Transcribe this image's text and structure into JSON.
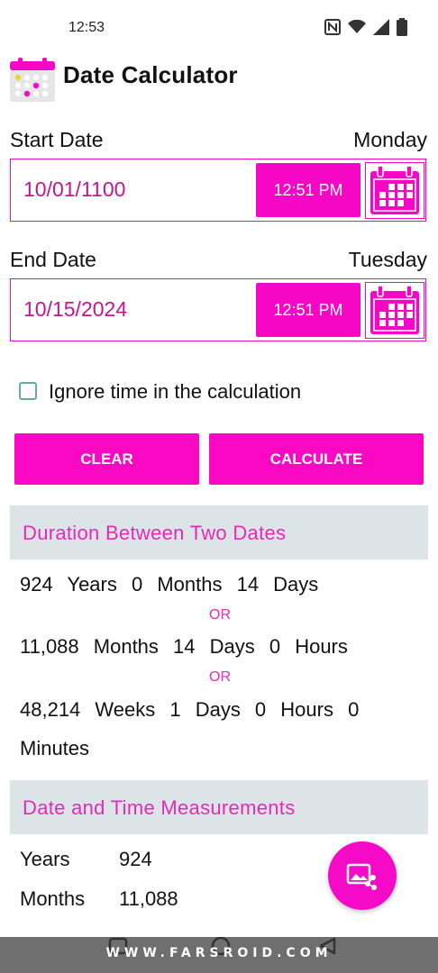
{
  "status_bar": {
    "time": "12:53",
    "icons": [
      "nfc-icon",
      "wifi-icon",
      "signal-icon",
      "battery-icon"
    ]
  },
  "app_bar": {
    "title": "Date Calculator",
    "icon": "calendar-app-icon"
  },
  "start": {
    "label": "Start Date",
    "weekday": "Monday",
    "date": "10/01/1100",
    "time": "12:51 PM"
  },
  "end": {
    "label": "End Date",
    "weekday": "Tuesday",
    "date": "10/15/2024",
    "time": "12:51 PM"
  },
  "options": {
    "ignore_time_label": "Ignore time in the calculation",
    "ignore_time_checked": false
  },
  "buttons": {
    "clear": "CLEAR",
    "calculate": "CALCULATE"
  },
  "duration": {
    "title": "Duration Between Two Dates",
    "line1": "924 Years 0 Months 14 Days",
    "or1": "OR",
    "line2": "11,088 Months 14 Days 0 Hours",
    "or2": "OR",
    "line3a": "48,214 Weeks 1 Days 0 Hours 0",
    "line3b": "Minutes"
  },
  "measurements": {
    "title": "Date and Time Measurements",
    "rows": [
      {
        "label": "Years",
        "value": "924"
      },
      {
        "label": "Months",
        "value": "11,088"
      }
    ]
  },
  "watermark": "WWW.FARSROID.COM",
  "colors": {
    "accent": "#f507c5",
    "accent_text": "#c0168f",
    "section_bg": "#dde4e7"
  }
}
